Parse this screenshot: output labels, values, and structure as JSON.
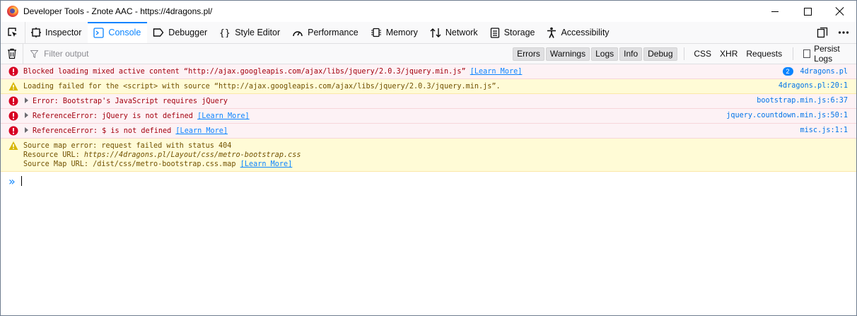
{
  "window": {
    "title": "Developer Tools - Znote AAC - https://4dragons.pl/"
  },
  "tabs": [
    {
      "label": "Inspector",
      "icon": "inspector-icon",
      "active": false
    },
    {
      "label": "Console",
      "icon": "console-icon",
      "active": true
    },
    {
      "label": "Debugger",
      "icon": "debugger-icon",
      "active": false
    },
    {
      "label": "Style Editor",
      "icon": "braces-icon",
      "active": false
    },
    {
      "label": "Performance",
      "icon": "gauge-icon",
      "active": false
    },
    {
      "label": "Memory",
      "icon": "chip-icon",
      "active": false
    },
    {
      "label": "Network",
      "icon": "arrows-icon",
      "active": false
    },
    {
      "label": "Storage",
      "icon": "storage-icon",
      "active": false
    },
    {
      "label": "Accessibility",
      "icon": "person-icon",
      "active": false
    }
  ],
  "toolbar": {
    "filter_placeholder": "Filter output",
    "levels": [
      "Errors",
      "Warnings",
      "Logs",
      "Info",
      "Debug"
    ],
    "net_filters": [
      "CSS",
      "XHR",
      "Requests"
    ],
    "persist_label": "Persist Logs"
  },
  "messages": [
    {
      "type": "error",
      "expandable": false,
      "text": "Blocked loading mixed active content “http://ajax.googleapis.com/ajax/libs/jquery/2.0.3/jquery.min.js”",
      "learn_more": "[Learn More]",
      "badge": "2",
      "source": "4dragons.pl"
    },
    {
      "type": "warn",
      "expandable": false,
      "text": "Loading failed for the <script> with source “http://ajax.googleapis.com/ajax/libs/jquery/2.0.3/jquery.min.js”.",
      "source": "4dragons.pl:20:1"
    },
    {
      "type": "error",
      "expandable": true,
      "text": "Error: Bootstrap's JavaScript requires jQuery",
      "source": "bootstrap.min.js:6:37"
    },
    {
      "type": "error",
      "expandable": true,
      "text": "ReferenceError: jQuery is not defined",
      "learn_more": "[Learn More]",
      "source": "jquery.countdown.min.js:50:1"
    },
    {
      "type": "error",
      "expandable": true,
      "text": "ReferenceError: $ is not defined",
      "learn_more": "[Learn More]",
      "source": "misc.js:1:1"
    },
    {
      "type": "warn",
      "expandable": false,
      "line1": "Source map error: request failed with status 404",
      "line2_label": "Resource URL: ",
      "line2_value": "https://4dragons.pl/Layout/css/metro-bootstrap.css",
      "line3_label": "Source Map URL: ",
      "line3_value": "/dist/css/metro-bootstrap.css.map",
      "learn_more": "[Learn More]"
    }
  ],
  "colors": {
    "accent": "#0a84ff",
    "error_bg": "#fdf2f5",
    "error_text": "#a4000f",
    "warn_bg": "#fffbd6",
    "warn_text": "#715100"
  }
}
